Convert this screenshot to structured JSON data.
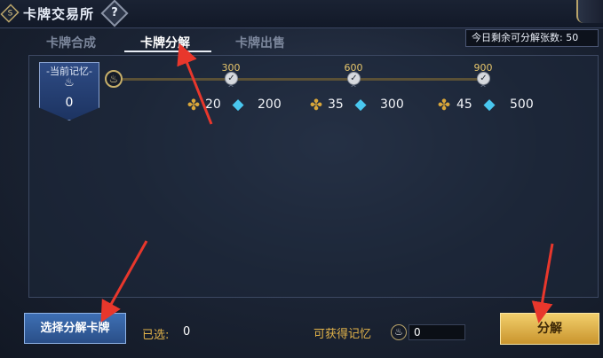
{
  "window": {
    "title": "卡牌交易所",
    "help_glyph": "?",
    "emblem_glyph": "S"
  },
  "tabs": [
    {
      "label": "卡牌合成",
      "active": false
    },
    {
      "label": "卡牌分解",
      "active": true
    },
    {
      "label": "卡牌出售",
      "active": false
    }
  ],
  "remaining": {
    "label": "今日剩余可分解张数:",
    "value": "50"
  },
  "memory": {
    "label": "-当前记忆-",
    "value": "0",
    "icon": "flame-icon"
  },
  "milestones": [
    {
      "threshold": "300",
      "puzzle_reward": "20",
      "gem_reward": "200"
    },
    {
      "threshold": "600",
      "puzzle_reward": "35",
      "gem_reward": "300"
    },
    {
      "threshold": "900",
      "puzzle_reward": "45",
      "gem_reward": "500"
    }
  ],
  "footer": {
    "select_button": "选择分解卡牌",
    "selected_label": "已选:",
    "selected_value": "0",
    "obtain_label": "可获得记忆",
    "obtain_value": "0",
    "decompose_button": "分解"
  },
  "colors": {
    "accent_gold": "#e2b34a",
    "button_blue": "#3e6fb4",
    "gem_blue": "#49c7ef",
    "annotation_red": "#e8372c"
  }
}
